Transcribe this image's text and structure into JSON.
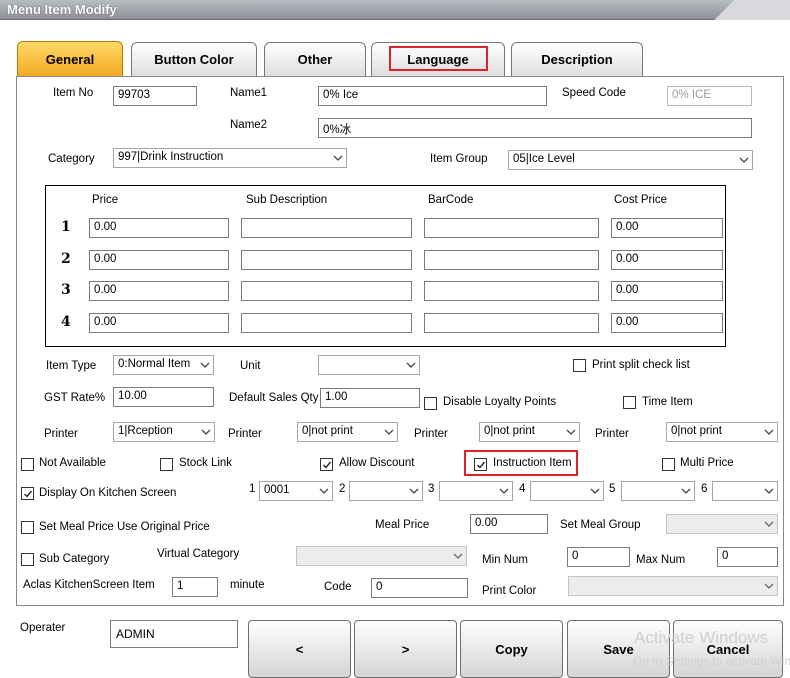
{
  "window": {
    "title": "Menu Item Modify"
  },
  "tabs": [
    {
      "label": "General"
    },
    {
      "label": "Button Color"
    },
    {
      "label": "Other"
    },
    {
      "label": "Language"
    },
    {
      "label": "Description"
    }
  ],
  "general": {
    "item_no_label": "Item No",
    "item_no": "99703",
    "name1_label": "Name1",
    "name1": "0% Ice",
    "speed_code_label": "Speed Code",
    "speed_code": "0% ICE",
    "name2_label": "Name2",
    "name2": "0%冰",
    "category_label": "Category",
    "category": "997|Drink Instruction",
    "item_group_label": "Item Group",
    "item_group": "05|Ice Level"
  },
  "price_table": {
    "headers": {
      "price": "Price",
      "sub_description": "Sub Description",
      "barcode": "BarCode",
      "cost_price": "Cost Price"
    },
    "rows": [
      {
        "num": "1",
        "price": "0.00",
        "sub": "",
        "barcode": "",
        "cost": "0.00"
      },
      {
        "num": "2",
        "price": "0.00",
        "sub": "",
        "barcode": "",
        "cost": "0.00"
      },
      {
        "num": "3",
        "price": "0.00",
        "sub": "",
        "barcode": "",
        "cost": "0.00"
      },
      {
        "num": "4",
        "price": "0.00",
        "sub": "",
        "barcode": "",
        "cost": "0.00"
      }
    ]
  },
  "options": {
    "item_type_label": "Item Type",
    "item_type": "0:Normal Item",
    "unit_label": "Unit",
    "unit": "",
    "print_split_label": "Print split check list",
    "gst_label": "GST Rate%",
    "gst": "10.00",
    "default_qty_label": "Default Sales Qty",
    "default_qty": "1.00",
    "disable_loyalty_label": "Disable Loyalty Points",
    "time_item_label": "Time Item",
    "printer_label": "Printer",
    "printers": [
      "1|Rception",
      "0|not print",
      "0|not print",
      "0|not print"
    ],
    "not_available_label": "Not Available",
    "stock_link_label": "Stock Link",
    "allow_discount_label": "Allow Discount",
    "instruction_item_label": "Instruction Item",
    "multi_price_label": "Multi Price",
    "display_kitchen_label": "Display On Kitchen Screen",
    "kitchen_screens": [
      {
        "num": "1",
        "value": "0001"
      },
      {
        "num": "2",
        "value": ""
      },
      {
        "num": "3",
        "value": ""
      },
      {
        "num": "4",
        "value": ""
      },
      {
        "num": "5",
        "value": ""
      },
      {
        "num": "6",
        "value": ""
      }
    ],
    "set_meal_original_label": "Set Meal Price Use Original Price",
    "meal_price_label": "Meal Price",
    "meal_price": "0.00",
    "set_meal_group_label": "Set Meal Group",
    "set_meal_group": "",
    "sub_category_label": "Sub Category",
    "virtual_category_label": "Virtual Category",
    "virtual_category": "",
    "min_num_label": "Min Num",
    "min_num": "0",
    "max_num_label": "Max Num",
    "max_num": "0",
    "aclas_label": "Aclas KitchenScreen Item",
    "aclas_minutes": "1",
    "minute_label": "minute",
    "code_label": "Code",
    "code": "0",
    "print_color_label": "Print Color",
    "print_color": ""
  },
  "checks": {
    "not_available": false,
    "stock_link": false,
    "allow_discount": true,
    "instruction_item": true,
    "multi_price": false,
    "display_kitchen": true,
    "set_meal_original": false,
    "sub_category": false,
    "print_split": false,
    "disable_loyalty": false,
    "time_item": false
  },
  "footer": {
    "operator_label": "Operater",
    "operator": "ADMIN",
    "prev": "<",
    "next": ">",
    "copy": "Copy",
    "save": "Save",
    "cancel": "Cancel"
  },
  "watermark": {
    "line1": "Activate Windows",
    "line2": "Go to Settings to activate Windows."
  },
  "colors": {
    "active_tab": "#f5b733",
    "highlight": "#d9242b"
  }
}
